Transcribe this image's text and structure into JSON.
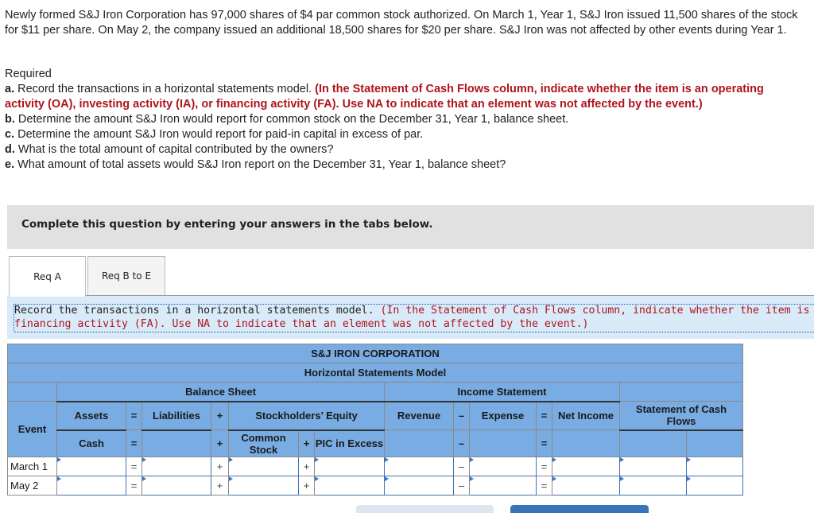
{
  "problem": {
    "intro": "Newly formed S&J Iron Corporation has 97,000 shares of $4 par common stock authorized. On March 1, Year 1, S&J Iron issued 11,500 shares of the stock for $11 per share. On May 2, the company issued an additional 18,500 shares for $20 per share. S&J Iron was not affected by other events during Year 1.",
    "required_label": "Required",
    "items": [
      {
        "letter": "a.",
        "text": "Record the transactions in a horizontal statements model.",
        "note": "(In the Statement of Cash Flows column, indicate whether the item is an operating activity (OA), investing activity (IA), or financing activity (FA). Use NA to indicate that an element was not affected by the event.)"
      },
      {
        "letter": "b.",
        "text": "Determine the amount S&J Iron would report for common stock on the December 31, Year 1, balance sheet."
      },
      {
        "letter": "c.",
        "text": "Determine the amount S&J Iron would report for paid-in capital in excess of par."
      },
      {
        "letter": "d.",
        "text": "What is the total amount of capital contributed by the owners?"
      },
      {
        "letter": "e.",
        "text": "What amount of total assets would S&J Iron report on the December 31, Year 1, balance sheet?"
      }
    ]
  },
  "banner": "Complete this question by entering your answers in the tabs below.",
  "tabs": [
    {
      "label": "Req A",
      "active": true
    },
    {
      "label": "Req B to E",
      "active": false
    }
  ],
  "instruction": {
    "text": "Record the transactions in a horizontal statements model.",
    "note_line1": "(In the Statement of Cash Flows column, indicate whether the item is an operating acti",
    "note_line2": "financing activity (FA). Use NA to indicate that an element was not affected by the event.)"
  },
  "table": {
    "company": "S&J IRON CORPORATION",
    "title": "Horizontal Statements Model",
    "balance_sheet": "Balance Sheet",
    "income_statement": "Income Statement",
    "event_label": "Event",
    "assets": "Assets",
    "liabilities": "Liabilities",
    "stockholders_equity": "Stockholders’ Equity",
    "cash": "Cash",
    "common_stock": "Common Stock",
    "pic_in_excess": "PIC in Excess",
    "revenue": "Revenue",
    "expense": "Expense",
    "net_income": "Net Income",
    "cash_flows": "Statement of Cash Flows",
    "ops": {
      "eq": "=",
      "plus": "+",
      "minus": "–"
    },
    "rows": [
      {
        "event": "March 1",
        "cash": "",
        "liabilities": "",
        "common_stock": "",
        "pic": "",
        "revenue": "",
        "expense": "",
        "net_income": "",
        "cf_amount": "",
        "cf_activity": ""
      },
      {
        "event": "May 2",
        "cash": "",
        "liabilities": "",
        "common_stock": "",
        "pic": "",
        "revenue": "",
        "expense": "",
        "net_income": "",
        "cf_amount": "",
        "cf_activity": ""
      }
    ]
  }
}
